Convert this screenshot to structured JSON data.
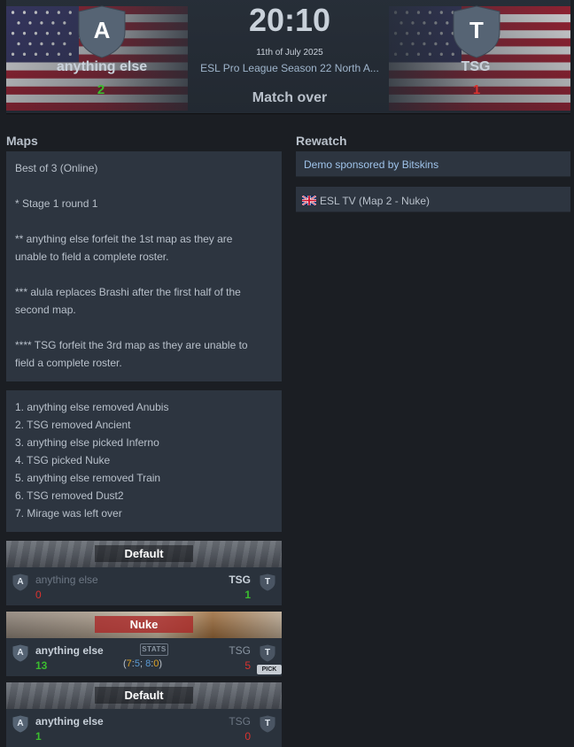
{
  "match": {
    "time": "20:10",
    "date": "11th of July 2025",
    "event": "ESL Pro League Season 22 North A...",
    "status": "Match over",
    "team1": {
      "name": "anything else",
      "logo_letter": "A",
      "score": "2",
      "flag_icon": "usa-flag-icon"
    },
    "team2": {
      "name": "TSG",
      "logo_letter": "T",
      "score": "1",
      "flag_icon": "usa-flag-icon"
    }
  },
  "maps": {
    "title": "Maps",
    "notes": [
      "Best of 3 (Online)",
      "* Stage 1 round 1",
      "** anything else forfeit the 1st map as they are",
      "unable to field a complete roster.",
      "*** alula replaces Brashi after the first half of the",
      "second map.",
      "**** TSG forfeit the 3rd map as they are unable to",
      "field a complete roster."
    ],
    "veto": [
      "1. anything else removed Anubis",
      "2. TSG removed Ancient",
      "3. anything else picked Inferno",
      "4. TSG picked Nuke",
      "5. anything else removed Train",
      "6. TSG removed Dust2",
      "7. Mirage was left over"
    ],
    "cards": [
      {
        "map_name": "Default",
        "team1_name": "anything else",
        "team1_logo": "A",
        "team1_score": "0",
        "team2_name": "TSG",
        "team2_logo": "T",
        "team2_score": "1"
      },
      {
        "map_name": "Nuke",
        "team1_name": "anything else",
        "team1_logo": "A",
        "team1_score": "13",
        "team2_name": "TSG",
        "team2_logo": "T",
        "team2_score": "5",
        "stats_label": "STATS",
        "halves": {
          "open": "(",
          "h1_ct": "7",
          "sep1": ":",
          "h1_t": "5",
          "mid": "; ",
          "h2_ct": "8",
          "sep2": ":",
          "h2_t": "0",
          "close": ")"
        },
        "pick_label": "PICK"
      },
      {
        "map_name": "Default",
        "team1_name": "anything else",
        "team1_logo": "A",
        "team1_score": "1",
        "team2_name": "TSG",
        "team2_logo": "T",
        "team2_score": "0"
      }
    ]
  },
  "rewatch": {
    "title": "Rewatch",
    "demo": "Demo sponsored by Bitskins",
    "stream": "ESL TV (Map 2 - Nuke)",
    "stream_flag_icon": "uk-flag-icon"
  },
  "colors": {
    "win": "#3bbd2f",
    "loss": "#d9322f",
    "ct": "#5b9bd5",
    "t": "#e0a526",
    "link": "#9fc3ea"
  }
}
